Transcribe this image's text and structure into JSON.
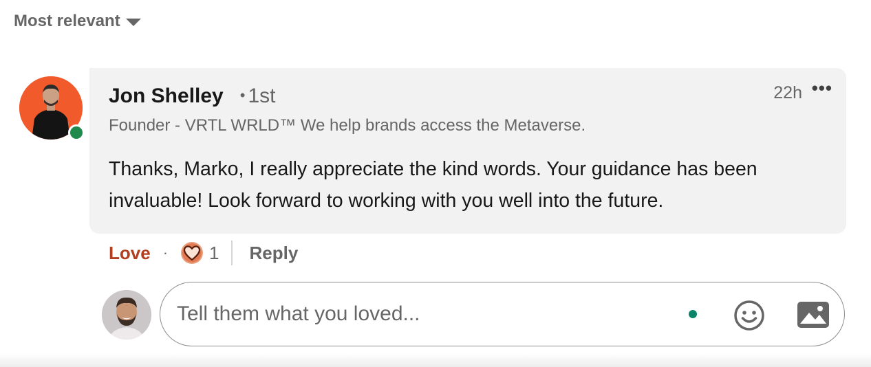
{
  "sort": {
    "label": "Most relevant"
  },
  "comment": {
    "author": "Jon Shelley",
    "degree": "1st",
    "degree_separator": "•",
    "headline": "Founder - VRTL WRLD™ We help brands access the Metaverse.",
    "time": "22h",
    "more": "•••",
    "text": "Thanks, Marko, I really appreciate the kind words. Your guidance has been invaluable! Look forward to working with you well into the future."
  },
  "actions": {
    "love_label": "Love",
    "separator": "·",
    "reaction_count": "1",
    "reply_label": "Reply"
  },
  "reply_box": {
    "placeholder": "Tell them what you loved..."
  },
  "colors": {
    "love": "#b24020",
    "avatar_bg": "#f15a2b",
    "presence": "#1f8a4c",
    "typing_dot": "#0a8569",
    "bubble_bg": "#f2f2f2"
  },
  "icons": {
    "sort": "caret-down-icon",
    "presence": "online-status-icon",
    "reaction": "love-heart-reaction-icon",
    "emoji": "smiley-face-icon",
    "image": "image-icon",
    "more": "ellipsis-icon"
  }
}
